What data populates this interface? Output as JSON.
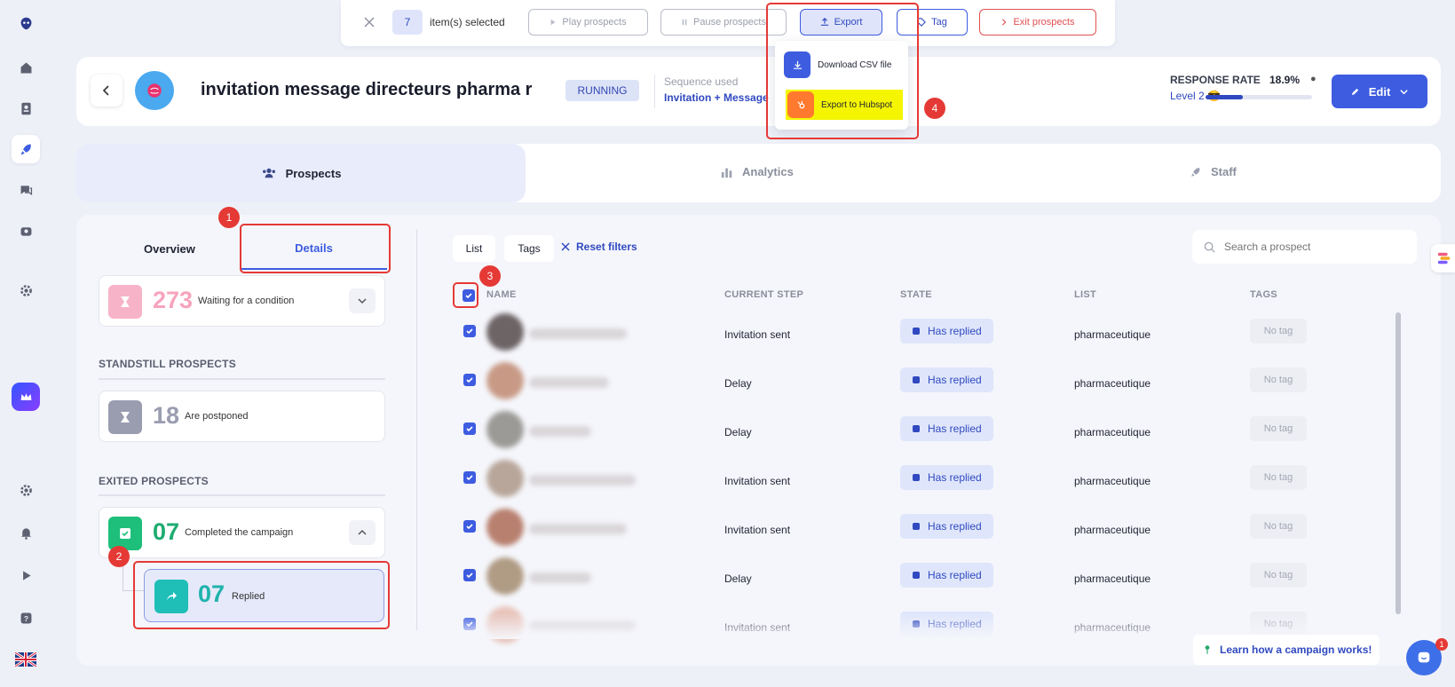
{
  "topbar": {
    "count": "7",
    "selected_label": "item(s) selected",
    "play": "Play prospects",
    "pause": "Pause prospects",
    "export": "Export",
    "tag": "Tag",
    "exit": "Exit prospects"
  },
  "export_menu": {
    "csv": "Download CSV file",
    "hubspot": "Export to Hubspot"
  },
  "header": {
    "title": "invitation message directeurs pharma r",
    "status": "RUNNING",
    "sequence_label": "Sequence used",
    "sequence_name": "Invitation + Message",
    "response_label": "RESPONSE RATE",
    "response_value": "18.9%",
    "level": "Level 2 😎",
    "level_progress": 0.35,
    "edit": "Edit"
  },
  "tabs": {
    "prospects": "Prospects",
    "analytics": "Analytics",
    "staff": "Staff"
  },
  "subtabs": {
    "overview": "Overview",
    "details": "Details"
  },
  "left": {
    "waiting_num": "273",
    "waiting_lbl": "Waiting for a condition",
    "standstill_title": "STANDSTILL PROSPECTS",
    "postponed_num": "18",
    "postponed_lbl": "Are postponed",
    "exited_title": "EXITED PROSPECTS",
    "completed_num": "07",
    "completed_lbl": "Completed the campaign",
    "replied_num": "07",
    "replied_lbl": "Replied"
  },
  "filters": {
    "list": "List",
    "tags": "Tags",
    "reset": "Reset filters",
    "search_placeholder": "Search a prospect"
  },
  "table": {
    "headers": {
      "name": "NAME",
      "step": "CURRENT STEP",
      "state": "STATE",
      "list": "LIST",
      "tags": "TAGS"
    },
    "rows": [
      {
        "step": "Invitation sent",
        "state": "Has replied",
        "list": "pharmaceutique",
        "tags": "No tag"
      },
      {
        "step": "Delay",
        "state": "Has replied",
        "list": "pharmaceutique",
        "tags": "No tag"
      },
      {
        "step": "Delay",
        "state": "Has replied",
        "list": "pharmaceutique",
        "tags": "No tag"
      },
      {
        "step": "Invitation sent",
        "state": "Has replied",
        "list": "pharmaceutique",
        "tags": "No tag"
      },
      {
        "step": "Invitation sent",
        "state": "Has replied",
        "list": "pharmaceutique",
        "tags": "No tag"
      },
      {
        "step": "Delay",
        "state": "Has replied",
        "list": "pharmaceutique",
        "tags": "No tag"
      },
      {
        "step": "Invitation sent",
        "state": "Has replied",
        "list": "pharmaceutique",
        "tags": "No tag"
      }
    ]
  },
  "footer": {
    "learn": "Learn how a campaign works!",
    "chat_badge": "1"
  },
  "annotations": [
    "1",
    "2",
    "3",
    "4"
  ],
  "colors": {
    "accent": "#3d5ce0",
    "danger": "#e53935",
    "highlight": "#f5f500",
    "hubspot": "#ff7a2f"
  }
}
